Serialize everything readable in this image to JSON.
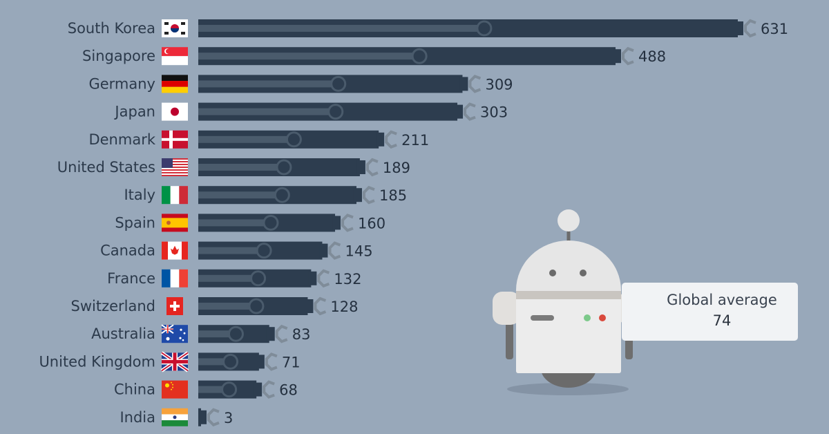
{
  "chart_data": {
    "type": "bar",
    "orientation": "horizontal",
    "title": "",
    "xlabel": "",
    "ylabel": "",
    "xlim": [
      0,
      631
    ],
    "grid": false,
    "legend": "none",
    "categories": [
      "South Korea",
      "Singapore",
      "Germany",
      "Japan",
      "Denmark",
      "United States",
      "Italy",
      "Spain",
      "Canada",
      "France",
      "Switzerland",
      "Australia",
      "United Kingdom",
      "China",
      "India"
    ],
    "values": [
      631,
      488,
      309,
      303,
      211,
      189,
      185,
      160,
      145,
      132,
      128,
      83,
      71,
      68,
      3
    ],
    "flags": [
      "kr",
      "sg",
      "de",
      "jp",
      "dk",
      "us",
      "it",
      "es",
      "ca",
      "fr",
      "ch",
      "au",
      "gb",
      "cn",
      "in"
    ],
    "annotation": {
      "label": "Global average",
      "value": 74
    }
  },
  "colors": {
    "background": "#98a8ba",
    "bar": "#2d3d4f",
    "bar_inner": "#4a5b6c",
    "claw": "#7f8c99",
    "label": "#2c3a4b"
  }
}
